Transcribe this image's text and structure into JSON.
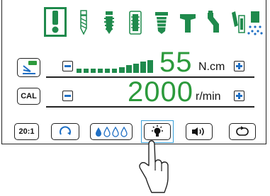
{
  "tools": [
    {
      "name": "endo-file-icon",
      "selected": true
    },
    {
      "name": "drill-icon"
    },
    {
      "name": "implant-screw-icon"
    },
    {
      "name": "bone-tap-icon"
    },
    {
      "name": "implant-fixture-icon"
    },
    {
      "name": "abutment-icon"
    },
    {
      "name": "handpiece-icon"
    },
    {
      "name": "surgical-handpiece-icon"
    },
    {
      "name": "irrigation-spray-icon"
    }
  ],
  "torque": {
    "value": "55",
    "unit": "N.cm",
    "level_fraction": 1.0
  },
  "speed": {
    "value": "2000",
    "unit": "r/min"
  },
  "buttons": {
    "cal_label": "CAL",
    "ratio_label": "20:1"
  },
  "colors": {
    "accent_green": "#2c9a3c",
    "icon_blue": "#1f6fc4",
    "selection_green": "#1f8a4c"
  }
}
